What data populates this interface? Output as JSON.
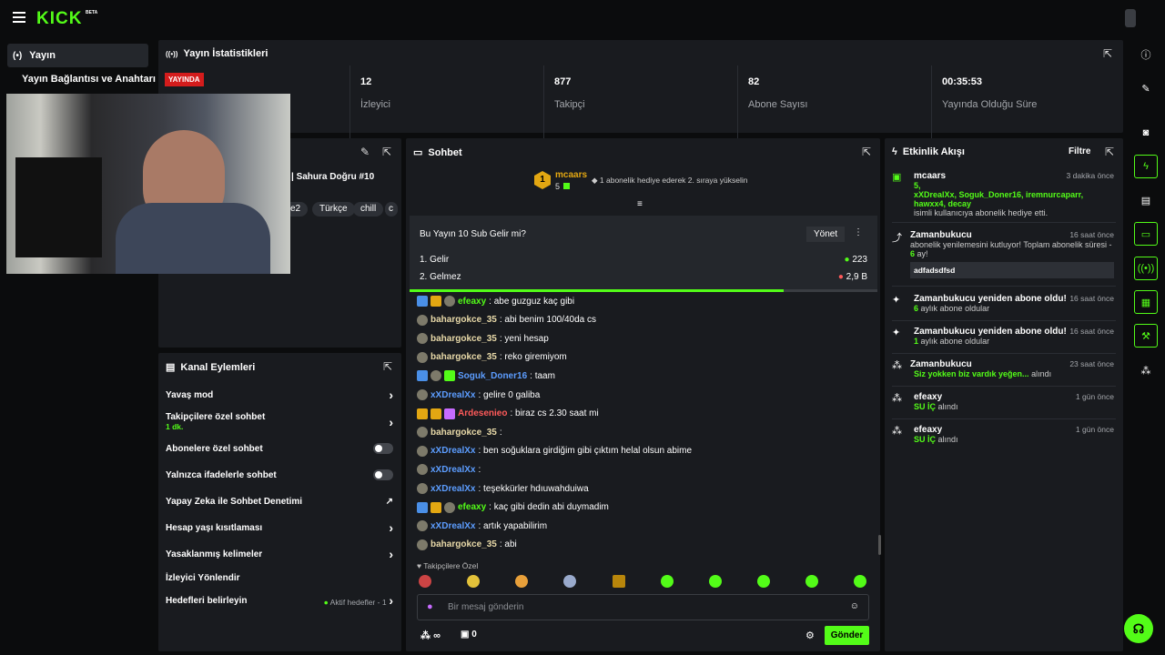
{
  "topbar": {
    "logo": "KICK",
    "logo_beta": "BETA"
  },
  "nav": {
    "active": "Yayın",
    "item2": "Yayın Bağlantısı ve Anahtarı"
  },
  "stats": {
    "title": "Yayın İstatistikleri",
    "live_badge": "YAYINDA",
    "items": [
      {
        "value": "12",
        "label": "İzleyici"
      },
      {
        "value": "877",
        "label": "Takipçi"
      },
      {
        "value": "82",
        "label": "Abone Sayısı"
      },
      {
        "value": "00:35:53",
        "label": "Yayında Olduğu Süre"
      }
    ]
  },
  "stream_info": {
    "title_fragment": "| Sahura Doğru #10",
    "tags": [
      "ke2",
      "Türkçe",
      "chill",
      "c"
    ]
  },
  "actions": {
    "title": "Kanal Eylemleri",
    "items": [
      {
        "label": "Yavaş mod",
        "control": "chevron"
      },
      {
        "label": "Takipçilere özel sohbet",
        "sub": "1 dk.",
        "control": "chevron"
      },
      {
        "label": "Abonelere özel sohbet",
        "control": "toggle"
      },
      {
        "label": "Yalnızca ifadelerle sohbet",
        "control": "toggle"
      },
      {
        "label": "Yapay Zeka ile Sohbet Denetimi",
        "control": "external"
      },
      {
        "label": "Hesap yaşı kısıtlaması",
        "control": "chevron"
      },
      {
        "label": "Yasaklanmış kelimeler",
        "control": "chevron"
      },
      {
        "label": "İzleyici Yönlendir",
        "control": "none"
      },
      {
        "label": "Hedefleri belirleyin",
        "extra": "Aktif hedefler - 1",
        "control": "chevron"
      }
    ]
  },
  "chat": {
    "title": "Sohbet",
    "top_gifter": {
      "rank": "1",
      "name": "mcaars",
      "count": "5",
      "message": "1 abonelik hediye ederek 2. sıraya yükselin"
    },
    "poll": {
      "question": "Bu Yayın 10 Sub Gelir mi?",
      "manage": "Yönet",
      "options": [
        {
          "label": "1. Gelir",
          "votes": "223"
        },
        {
          "label": "2. Gelmez",
          "votes": "2,9 B"
        }
      ],
      "progress": 0.8
    },
    "messages": [
      {
        "user": "efeaxy",
        "color": "u-green",
        "badges": [
          "b-mod",
          "b-vip",
          "b-sub"
        ],
        "text": ": abe guzguz kaç gibi"
      },
      {
        "user": "bahargokce_35",
        "color": "u-tan",
        "badges": [
          "b-sub"
        ],
        "text": ": abi benim 100/40da cs"
      },
      {
        "user": "bahargokce_35",
        "color": "u-tan",
        "badges": [
          "b-sub"
        ],
        "text": ": yeni hesap"
      },
      {
        "user": "bahargokce_35",
        "color": "u-tan",
        "badges": [
          "b-sub"
        ],
        "text": ": reko giremiyom"
      },
      {
        "user": "Soguk_Doner16",
        "color": "u-blue",
        "badges": [
          "b-mod",
          "b-sub",
          "b-grn"
        ],
        "text": ": taam"
      },
      {
        "user": "xXDrealXx",
        "color": "u-blue",
        "badges": [
          "b-sub"
        ],
        "text": ": gelire 0 galiba"
      },
      {
        "user": "Ardesenieo",
        "color": "u-red",
        "badges": [
          "b-vip",
          "b-vip",
          "b-prp"
        ],
        "text": ": biraz cs 2.30 saat mi"
      },
      {
        "user": "bahargokce_35",
        "color": "u-tan",
        "badges": [
          "b-sub"
        ],
        "text": ":"
      },
      {
        "user": "xXDrealXx",
        "color": "u-blue",
        "badges": [
          "b-sub"
        ],
        "text": ": ben soğuklara girdiğim gibi çıktım helal olsun abime"
      },
      {
        "user": "xXDrealXx",
        "color": "u-blue",
        "badges": [
          "b-sub"
        ],
        "text": ":"
      },
      {
        "user": "xXDrealXx",
        "color": "u-blue",
        "badges": [
          "b-sub"
        ],
        "text": ": teşekkürler hdıuwahduiwa"
      },
      {
        "user": "efeaxy",
        "color": "u-green",
        "badges": [
          "b-mod",
          "b-vip",
          "b-sub"
        ],
        "text": ": kaç gibi dedin abi duymadim"
      },
      {
        "user": "xXDrealXx",
        "color": "u-blue",
        "badges": [
          "b-sub"
        ],
        "text": ": artık yapabilirim"
      },
      {
        "user": "bahargokce_35",
        "color": "u-tan",
        "badges": [
          "b-sub"
        ],
        "text": ": abi"
      }
    ],
    "followers_only": "Takipçilere Özel",
    "input_placeholder": "Bir mesaj gönderin",
    "points": "∞",
    "gift_count": "0",
    "send": "Gönder"
  },
  "activity": {
    "title": "Etkinlik Akışı",
    "filter": "Filtre",
    "events": [
      {
        "title": "mcaars",
        "time": "3 dakika önce",
        "count": "5,",
        "names": "xXDrealXx, Soguk_Doner16, iremnurcaparr, hawxx4, decay",
        "desc": "isimli kullanıcıya abonelik hediye etti."
      },
      {
        "title": "Zamanbukucu",
        "time": "16 saat önce",
        "desc": "abonelik yenilemesini kutluyor! Toplam abonelik süresi - ",
        "months": "6",
        "desc2": "ay!",
        "message": "adfadsdfsd"
      },
      {
        "title": "Zamanbukucu yeniden abone oldu!",
        "time": "16 saat önce",
        "months": "6",
        "desc": "aylık abone oldular"
      },
      {
        "title": "Zamanbukucu yeniden abone oldu!",
        "time": "16 saat önce",
        "months": "1",
        "desc": "aylık abone oldular"
      },
      {
        "title": "Zamanbukucu",
        "time": "23 saat önce",
        "reward": "Siz yokken biz vardık yeğen...",
        "desc": "alındı"
      },
      {
        "title": "efeaxy",
        "time": "1 gün önce",
        "reward": "SU İÇ",
        "desc": "alındı"
      },
      {
        "title": "efeaxy",
        "time": "1 gün önce",
        "reward": "SU İÇ",
        "desc": "alındı"
      }
    ]
  }
}
